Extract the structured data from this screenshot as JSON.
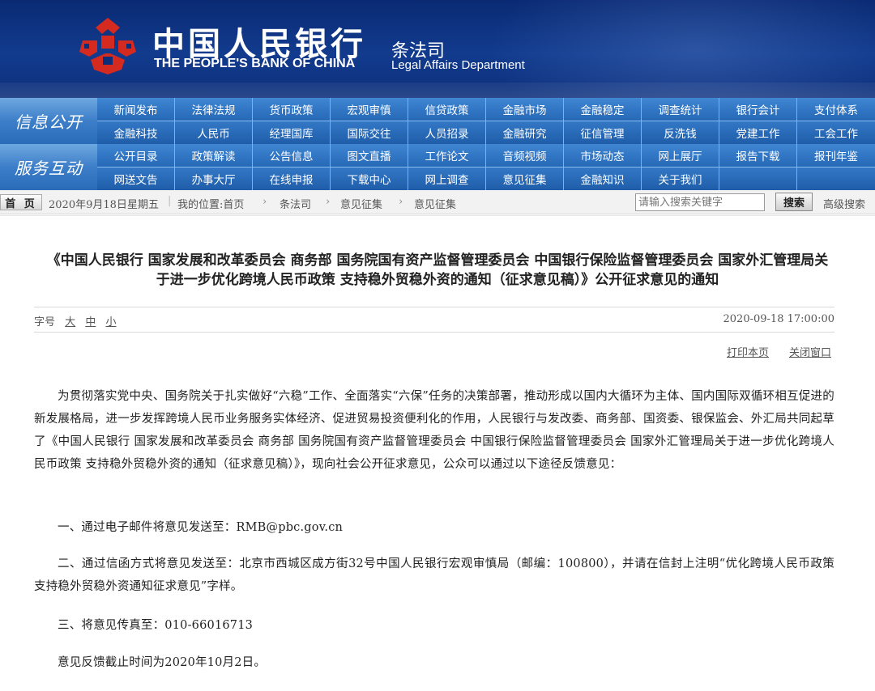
{
  "header": {
    "bank_name_cn": "中国人民银行",
    "bank_name_en": "THE PEOPLE'S BANK OF CHINA",
    "dept_cn": "条法司",
    "dept_en": "Legal Affairs Department",
    "colors": {
      "banner": "#0d2f7a",
      "logo_red": "#d42a20",
      "nav": "#2568b7"
    }
  },
  "nav": {
    "section1_label": "信息公开",
    "section1_row1": [
      "新闻发布",
      "法律法规",
      "货币政策",
      "宏观审慎",
      "信贷政策",
      "金融市场",
      "金融稳定",
      "调查统计",
      "银行会计",
      "支付体系"
    ],
    "section1_row2": [
      "金融科技",
      "人民币",
      "经理国库",
      "国际交往",
      "人员招录",
      "金融研究",
      "征信管理",
      "反洗钱",
      "党建工作",
      "工会工作"
    ],
    "section2_label": "服务互动",
    "section2_row1": [
      "公开目录",
      "政策解读",
      "公告信息",
      "图文直播",
      "工作论文",
      "音频视频",
      "市场动态",
      "网上展厅",
      "报告下载",
      "报刊年鉴"
    ],
    "section2_row2": [
      "网送文告",
      "办事大厅",
      "在线申报",
      "下载中心",
      "网上调查",
      "意见征集",
      "金融知识",
      "关于我们",
      "",
      ""
    ]
  },
  "breadcrumb": {
    "home": "首 页",
    "date": "2020年9月18日",
    "weekday": "星期五",
    "location": "我的位置:首页",
    "items": [
      "条法司",
      "意见征集",
      "意见征集"
    ],
    "search_placeholder": "请输入搜索关键字",
    "search_button": "搜索",
    "advanced_search": "高级搜索"
  },
  "article": {
    "title_line1": "《中国人民银行 国家发展和改革委员会 商务部 国务院国有资产监督管理委员会 中国银行保险监督管理委员会 国家外汇管理局关",
    "title_line2": "于进一步优化跨境人民币政策 支持稳外贸稳外资的通知（征求意见稿）》公开征求意见的通知",
    "font_size_label": "字号",
    "font_size_large": "大",
    "font_size_medium": "中",
    "font_size_small": "小",
    "timestamp": "2020-09-18 17:00:00",
    "print": "打印本页",
    "close": "关闭窗口",
    "paragraphs": [
      "为贯彻落实党中央、国务院关于扎实做好“六稳”工作、全面落实“六保”任务的决策部署，推动形成以国内大循环为主体、国内国际双循环相互促进的新发展格局，进一步发挥跨境人民币业务服务实体经济、促进贸易投资便利化的作用，人民银行与发改委、商务部、国资委、银保监会、外汇局共同起草了《中国人民银行 国家发展和改革委员会 商务部 国务院国有资产监督管理委员会 中国银行保险监督管理委员会 国家外汇管理局关于进一步优化跨境人民币政策 支持稳外贸稳外资的通知（征求意见稿）》，现向社会公开征求意见，公众可以通过以下途径反馈意见：",
      "一、通过电子邮件将意见发送至：RMB@pbc.gov.cn",
      "二、通过信函方式将意见发送至：北京市西城区成方街32号中国人民银行宏观审慎局（邮编：100800），并请在信封上注明“优化跨境人民币政策 支持稳外贸稳外资通知征求意见”字样。",
      "三、将意见传真至：010-66016713",
      "意见反馈截止时间为2020年10月2日。"
    ]
  }
}
